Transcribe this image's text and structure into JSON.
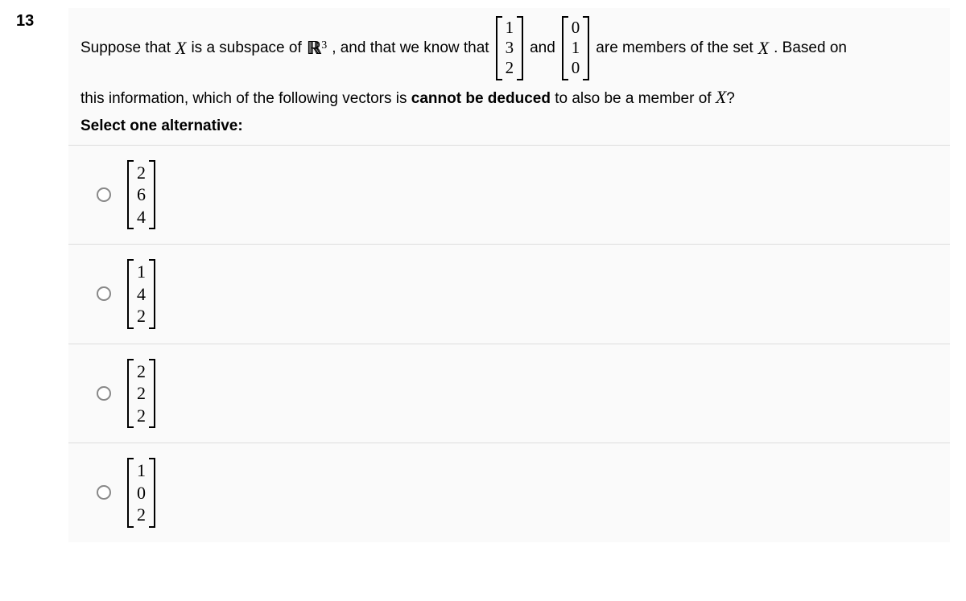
{
  "question_number": "13",
  "question": {
    "prefix": "Suppose that ",
    "var_X": "X",
    "mid1": " is a subspace of ",
    "space_R": "R",
    "sup_3": "3",
    "mid2": ", and that we know that ",
    "vec1": [
      "1",
      "3",
      "2"
    ],
    "and_text": " and ",
    "vec2": [
      "0",
      "1",
      "0"
    ],
    "mid3": " are members of the set ",
    "var_X2": "X",
    "mid4": ". Based on",
    "line2a": "this information, which of the following vectors is ",
    "cannot_be_deduced": "cannot be deduced",
    "line2b": " to also be a member of ",
    "var_X3": "X",
    "qmark": "?",
    "select_text": "Select one alternative:"
  },
  "options": [
    {
      "vector": [
        "2",
        "6",
        "4"
      ]
    },
    {
      "vector": [
        "1",
        "4",
        "2"
      ]
    },
    {
      "vector": [
        "2",
        "2",
        "2"
      ]
    },
    {
      "vector": [
        "1",
        "0",
        "2"
      ]
    }
  ]
}
